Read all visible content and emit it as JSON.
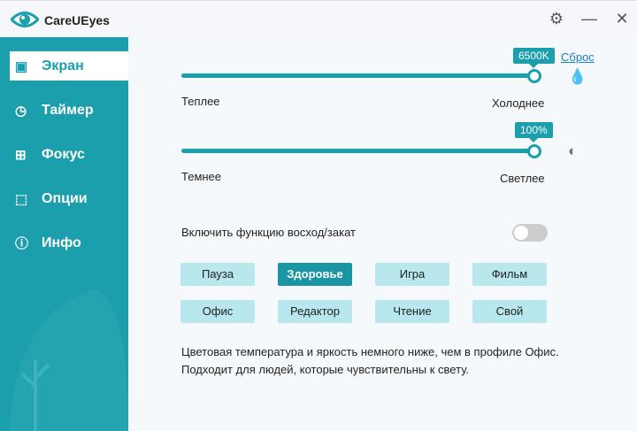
{
  "app": {
    "title": "CareUEyes"
  },
  "sidebar": {
    "items": [
      {
        "label": "Экран",
        "icon": "monitor-icon"
      },
      {
        "label": "Таймер",
        "icon": "clock-icon"
      },
      {
        "label": "Фокус",
        "icon": "windows-icon"
      },
      {
        "label": "Опции",
        "icon": "cursor-icon"
      },
      {
        "label": "Инфо",
        "icon": "info-icon"
      }
    ]
  },
  "temperature": {
    "value_label": "6500K",
    "value_percent": 100,
    "min_label": "Теплее",
    "max_label": "Холоднее",
    "reset": "Сброс"
  },
  "brightness": {
    "value_label": "100%",
    "value_percent": 100,
    "min_label": "Темнее",
    "max_label": "Светлее"
  },
  "sunrise": {
    "label": "Включить функцию восход/закат",
    "enabled": false
  },
  "profiles": [
    "Пауза",
    "Здоровье",
    "Игра",
    "Фильм",
    "Офис",
    "Редактор",
    "Чтение",
    "Свой"
  ],
  "active_profile": "Здоровье",
  "description": [
    "Цветовая температура и яркость немного ниже, чем в профиле Офис.",
    "Подходит для людей, которые чувствительны к свету."
  ],
  "colors": {
    "accent": "#1c9fad",
    "button": "#b8e7ee"
  }
}
